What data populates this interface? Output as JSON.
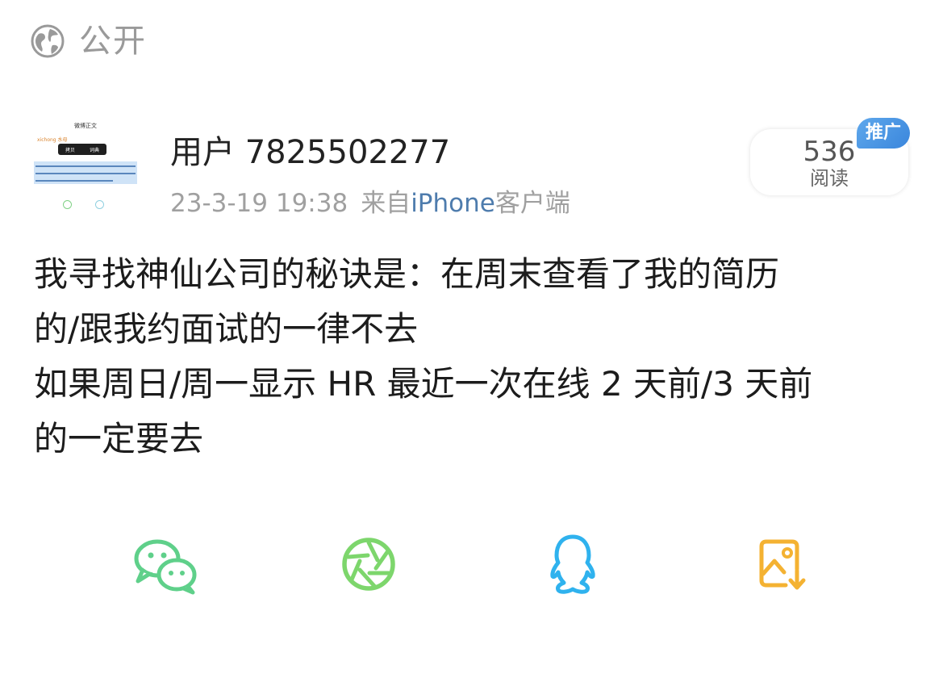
{
  "visibility": {
    "icon": "globe-icon",
    "label": "公开"
  },
  "post": {
    "author": {
      "name": "用户 7825502277",
      "avatar_thumbnail": {
        "title": "微博正文",
        "name": "xichong 水母",
        "tooltip_items": [
          "拷贝",
          "词典"
        ]
      }
    },
    "meta": {
      "timestamp": "23-3-19 19:38",
      "source_prefix": "来自",
      "source_device": "iPhone",
      "source_suffix": "客户端"
    },
    "reads": {
      "count": "536",
      "label": "阅读",
      "badge": "推广"
    },
    "content_lines": [
      "我寻找神仙公司的秘诀是：在周末查看了我的简历",
      "的/跟我约面试的一律不去",
      "如果周日/周一显示 HR 最近一次在线 2 天前/3 天前",
      "的一定要去"
    ]
  },
  "share": {
    "buttons": [
      {
        "name": "wechat-share-button",
        "icon": "wechat-icon",
        "color": "#5fd08a"
      },
      {
        "name": "moments-share-button",
        "icon": "moments-icon",
        "color": "#7dd66c"
      },
      {
        "name": "qq-share-button",
        "icon": "qq-icon",
        "color": "#2fb2ee"
      },
      {
        "name": "save-image-button",
        "icon": "save-image-icon",
        "color": "#f4b232"
      }
    ]
  }
}
